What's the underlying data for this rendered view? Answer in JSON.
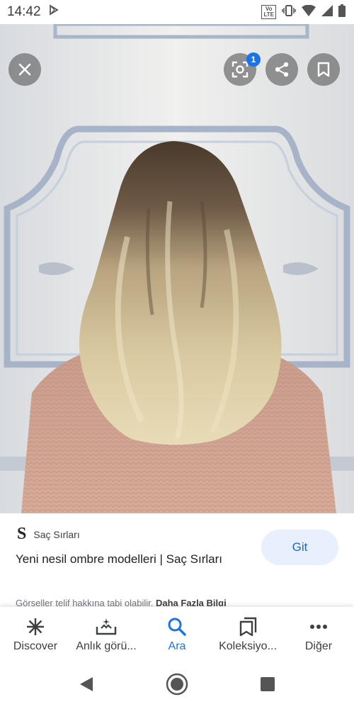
{
  "status_bar": {
    "time": "14:42",
    "volte_top": "Vo",
    "volte_bottom": "LTE"
  },
  "viewer": {
    "lens_badge_count": "1"
  },
  "result": {
    "source_logo": "S",
    "source_name": "Saç Sırları",
    "title": "Yeni nesil ombre modelleri | Saç Sırları",
    "go_label": "Git",
    "copyright_text": "Görseller telif hakkına tabi olabilir.",
    "more_info_link": "Daha Fazla Bilgi"
  },
  "bottom_nav": {
    "items": [
      {
        "label": "Discover",
        "icon": "asterisk-icon"
      },
      {
        "label": "Anlık görü...",
        "icon": "snapshot-icon"
      },
      {
        "label": "Ara",
        "icon": "search-icon"
      },
      {
        "label": "Koleksiyo...",
        "icon": "collections-icon"
      },
      {
        "label": "Diğer",
        "icon": "more-icon"
      }
    ],
    "active_index": 2
  },
  "colors": {
    "accent": "#1a73e8",
    "go_button_bg": "#e8f0fe"
  }
}
